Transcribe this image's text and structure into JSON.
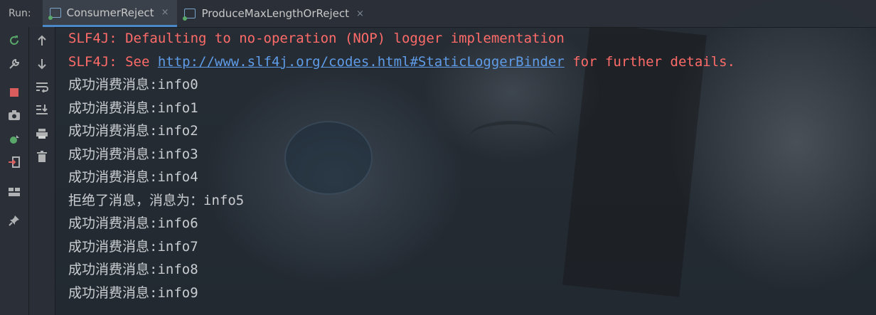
{
  "tabbar": {
    "run_label": "Run:",
    "tabs": [
      {
        "label": "ConsumerReject",
        "close": "×"
      },
      {
        "label": "ProduceMaxLengthOrReject",
        "close": "×"
      }
    ]
  },
  "console": {
    "err1": "SLF4J: Defaulting to no-operation (NOP) logger implementation",
    "err2_prefix": "SLF4J: See ",
    "err2_link": "http://www.slf4j.org/codes.html#StaticLoggerBinder",
    "err2_suffix": " for further details.",
    "lines": [
      "成功消费消息:info0",
      "成功消费消息:info1",
      "成功消费消息:info2",
      "成功消费消息:info3",
      "成功消费消息:info4",
      "拒绝了消息，消息为：info5",
      "成功消费消息:info6",
      "成功消费消息:info7",
      "成功消费消息:info8",
      "成功消费消息:info9"
    ]
  },
  "colors": {
    "error": "#ff6b68",
    "link": "#5f9ce8",
    "text": "#c9cdd1",
    "accent": "#4a88c7"
  },
  "icons": [
    "rerun-icon",
    "wrench-icon",
    "stop-icon",
    "camera-icon",
    "bug-icon",
    "exit-icon",
    "layout-icon",
    "pin-icon",
    "up-arrow-icon",
    "down-arrow-icon",
    "soft-wrap-icon",
    "scroll-to-end-icon",
    "print-icon",
    "trash-icon"
  ]
}
